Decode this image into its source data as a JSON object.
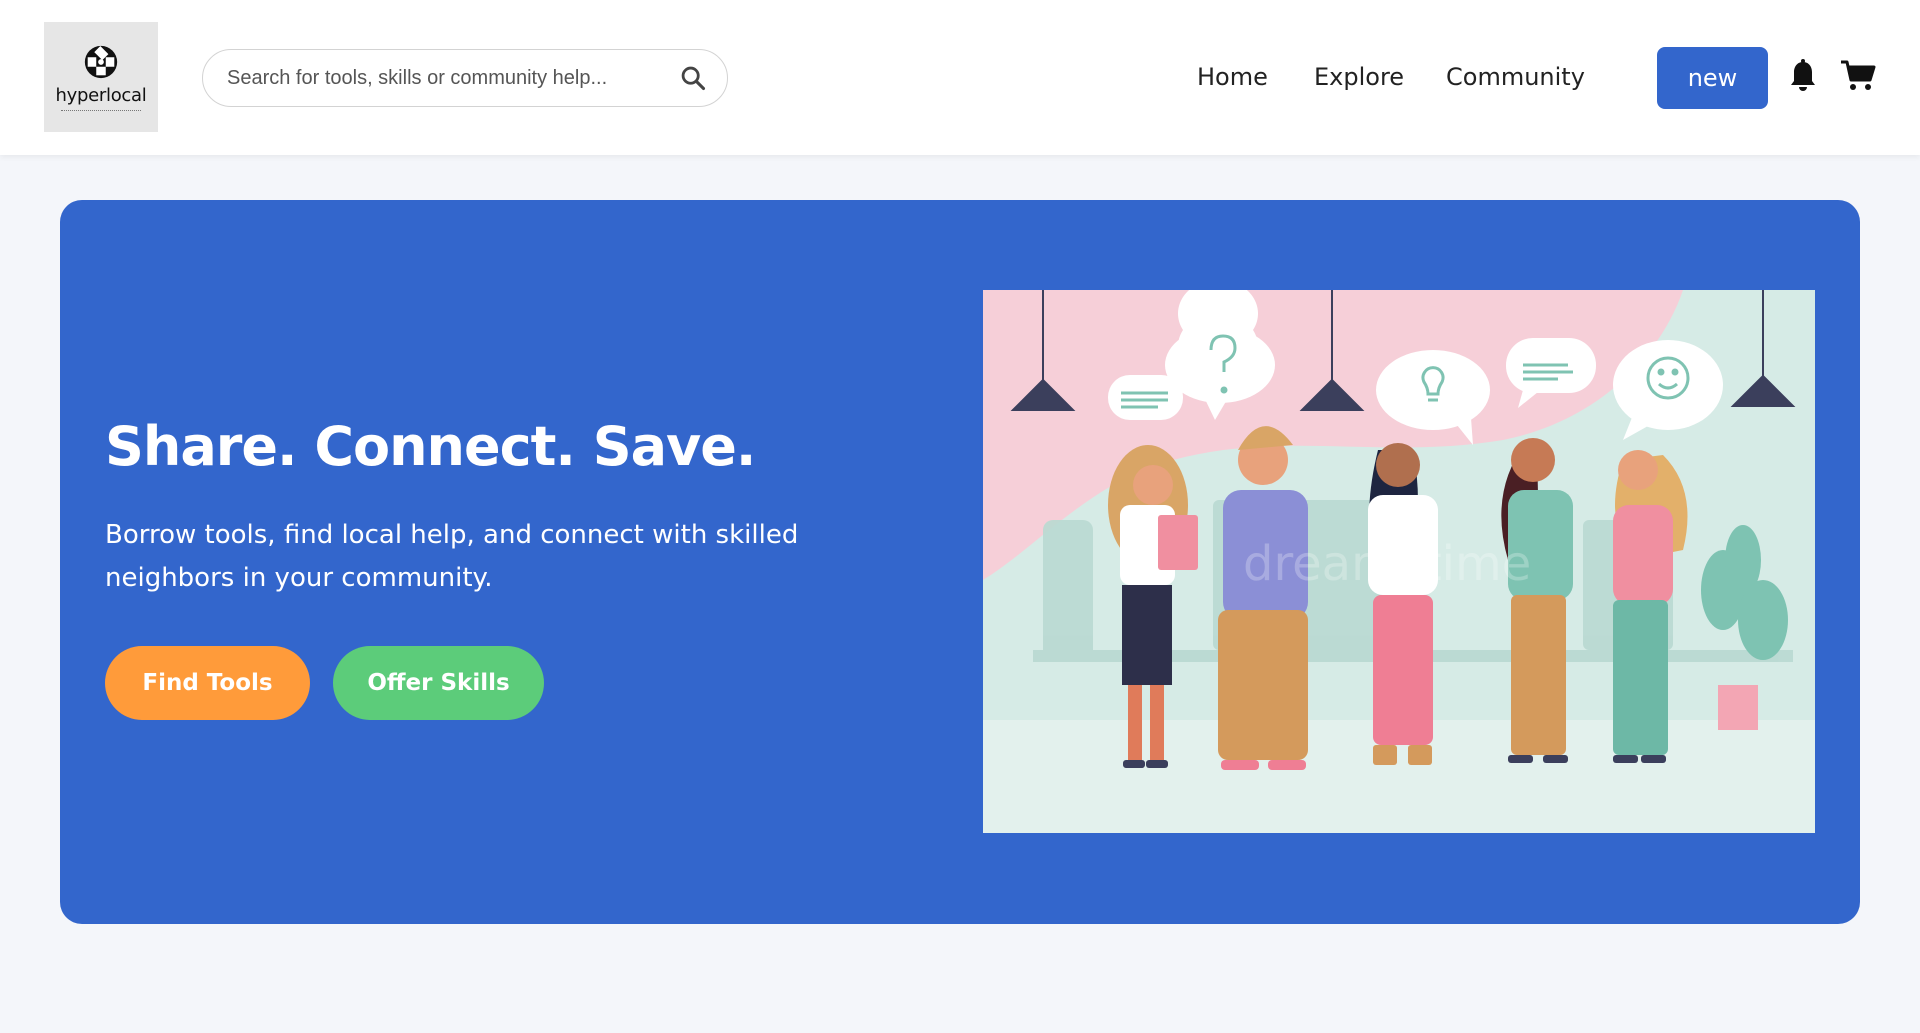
{
  "header": {
    "logo_text": "hyperlocal",
    "search": {
      "placeholder": "Search for tools, skills or community help...",
      "value": ""
    },
    "nav": [
      "Home",
      "Explore",
      "Community"
    ],
    "new_button": "new",
    "icons": [
      "search-icon",
      "bell-icon",
      "cart-icon"
    ]
  },
  "hero": {
    "title": "Share. Connect. Save.",
    "subtitle": "Borrow tools, find local help, and connect with skilled neighbors in your community.",
    "buttons": {
      "find_tools": "Find Tools",
      "offer_skills": "Offer Skills"
    },
    "image_watermark": "dreamstime"
  },
  "colors": {
    "primary": "#3366cc",
    "find_tools": "#ff9b3a",
    "offer_skills": "#5ccc7a",
    "page_bg": "#f4f6fa"
  }
}
